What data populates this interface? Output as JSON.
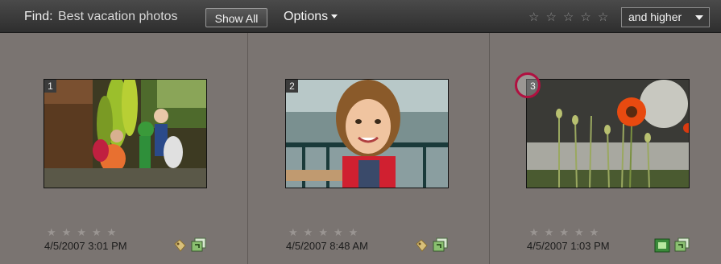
{
  "toolbar": {
    "find_label": "Find:",
    "find_query": "Best vacation photos",
    "show_all": "Show All",
    "options": "Options",
    "rating_filter": "and higher"
  },
  "colors": {
    "callout": "#b01040"
  },
  "photos": [
    {
      "number": "1",
      "date": "4/5/2007 3:01 PM",
      "icons": [
        "tag-icon",
        "stack-icon"
      ]
    },
    {
      "number": "2",
      "date": "4/5/2007 8:48 AM",
      "icons": [
        "tag-icon",
        "stack-icon"
      ]
    },
    {
      "number": "3",
      "date": "4/5/2007 1:03 PM",
      "icons": [
        "video-icon",
        "stack-icon"
      ]
    }
  ]
}
